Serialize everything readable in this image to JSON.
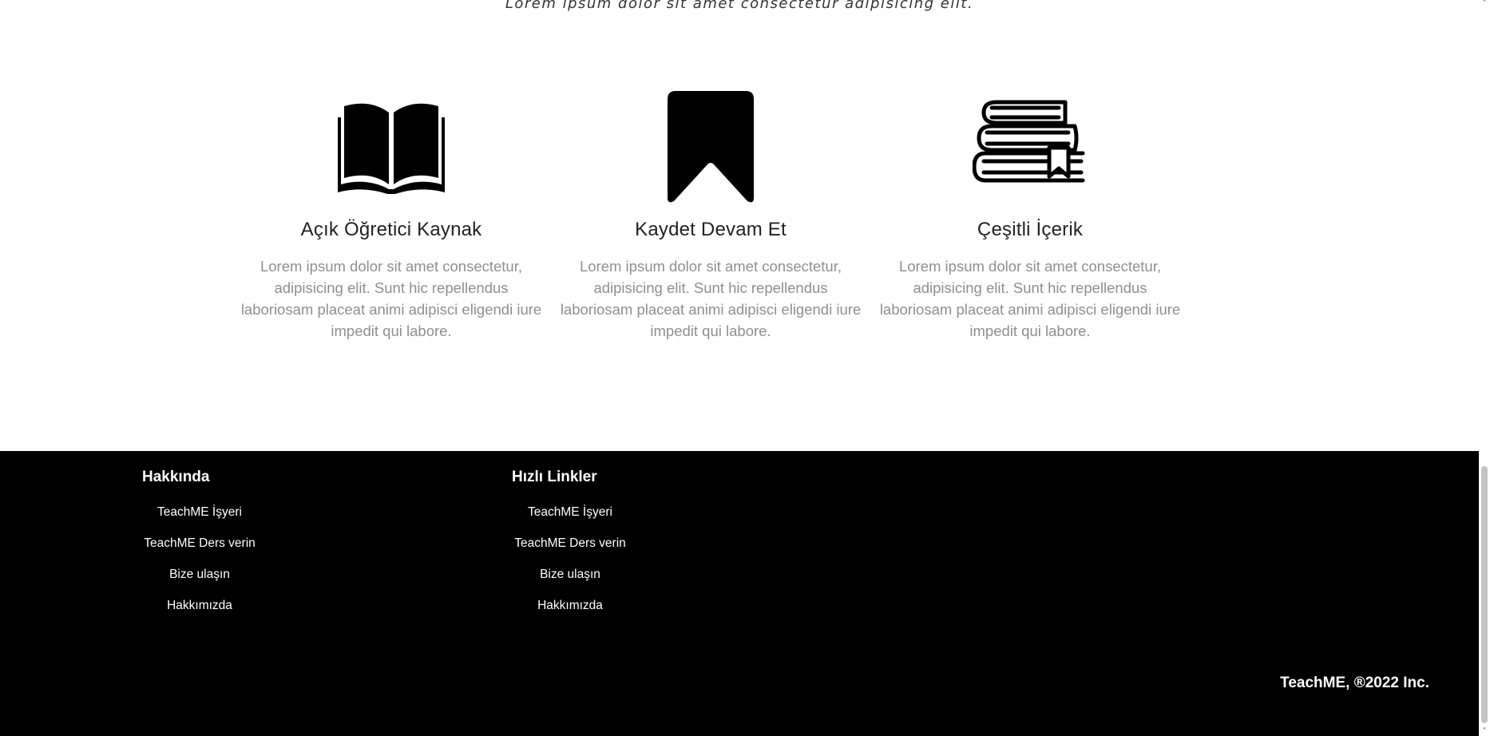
{
  "hero": {
    "subtitle": "Lorem ipsum dolor sit amet consectetur adipisicing elit."
  },
  "features": [
    {
      "icon": "open-book-icon",
      "title": "Açık Öğretici Kaynak",
      "text": "Lorem ipsum dolor sit amet consectetur, adipisicing elit. Sunt hic repellendus laboriosam placeat animi adipisci eligendi iure impedit qui labore."
    },
    {
      "icon": "bookmark-icon",
      "title": "Kaydet Devam Et",
      "text": "Lorem ipsum dolor sit amet consectetur, adipisicing elit. Sunt hic repellendus laboriosam placeat animi adipisci eligendi iure impedit qui labore."
    },
    {
      "icon": "stacked-books-icon",
      "title": "Çeşitli İçerik",
      "text": "Lorem ipsum dolor sit amet consectetur, adipisicing elit. Sunt hic repellendus laboriosam placeat animi adipisci eligendi iure impedit qui labore."
    }
  ],
  "footer": {
    "about": {
      "heading": "Hakkında",
      "links": [
        "TeachME İşyeri",
        "TeachME Ders verin",
        "Bize ulaşın",
        "Hakkımızda"
      ]
    },
    "quick_links": {
      "heading": "Hızlı Linkler",
      "links": [
        "TeachME İşyeri",
        "TeachME Ders verin",
        "Bize ulaşın",
        "Hakkımızda"
      ]
    },
    "copyright": "TeachME, ®2022 Inc."
  },
  "colors": {
    "footer_bg": "#000000",
    "body_text": "#8f8f8f",
    "heading_text": "#222222"
  },
  "scrollbar": {
    "up_arrow": "˄",
    "down_arrow": "˅"
  }
}
